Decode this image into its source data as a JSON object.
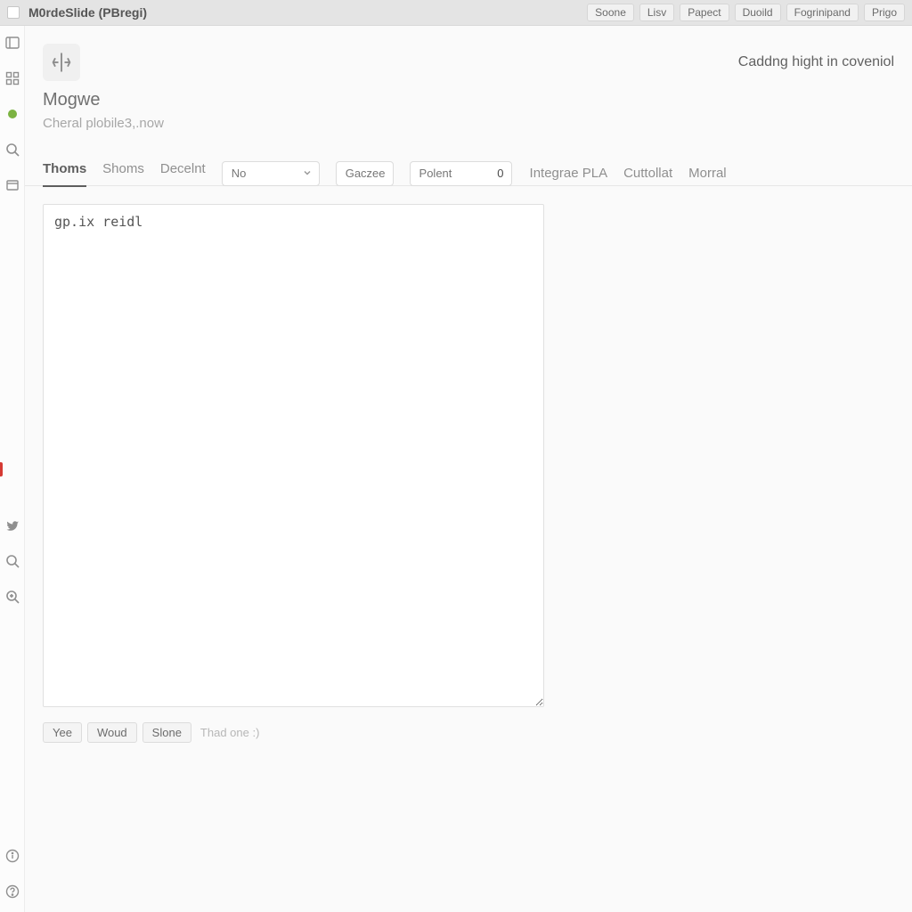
{
  "titlebar": {
    "title": "M0rdeSlide (PBregi)",
    "buttons": [
      "Soone",
      "Lisv",
      "Papect",
      "Duoild",
      "Fogrinipand",
      "Prigo"
    ]
  },
  "rail": {
    "icons": [
      "panel-icon",
      "grid-icon",
      "dot-icon",
      "search-icon",
      "box-icon"
    ],
    "lower_icons": [
      "bird-icon",
      "search2-icon",
      "zoom-icon"
    ],
    "bottom_icons": [
      "info-icon",
      "help-icon"
    ]
  },
  "header": {
    "status": "Caddng hight in coveniol",
    "title": "Mogwe",
    "subtitle": "Cheral plobile3,.now"
  },
  "tabrow": {
    "tabs": [
      {
        "label": "Thoms",
        "active": true
      },
      {
        "label": "Shoms",
        "active": false
      },
      {
        "label": "Decelnt",
        "active": false
      }
    ],
    "select1": {
      "value": "No"
    },
    "gaczee": {
      "label": "Gaczee"
    },
    "polent": {
      "label": "Polent",
      "value": "0"
    },
    "links": [
      "Integrae PLA",
      "Cuttollat",
      "Morral"
    ]
  },
  "editor": {
    "value": "gp.ix reidl"
  },
  "bottom": {
    "buttons": [
      "Yee",
      "Woud",
      "Slone"
    ],
    "hint": "Thad one :)"
  }
}
